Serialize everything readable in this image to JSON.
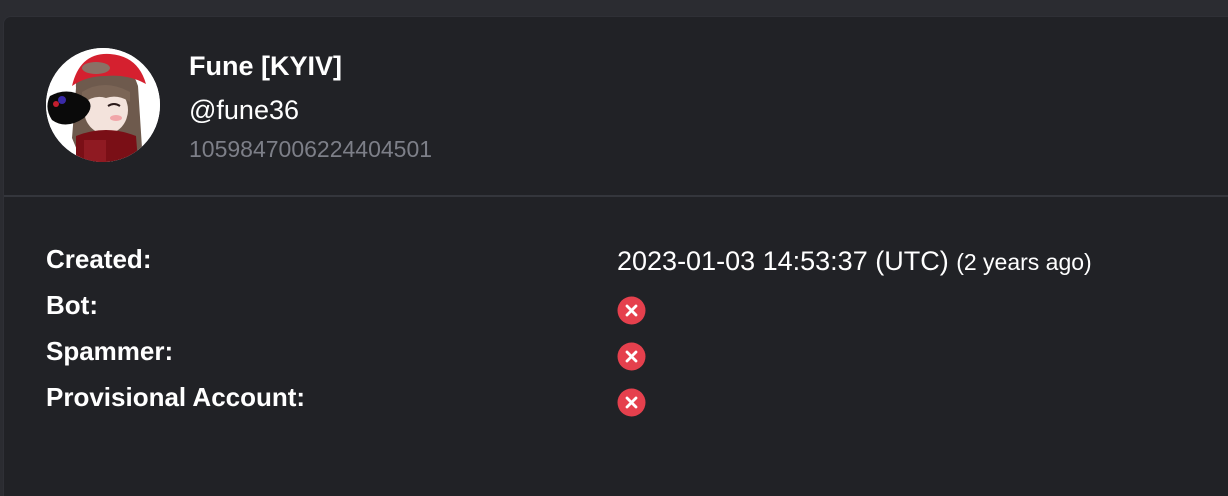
{
  "profile": {
    "display_name": "Fune [KYIV]",
    "username": "@fune36",
    "user_id": "1059847006224404501",
    "avatar_icon": "anime-avatar-red-cap"
  },
  "details": {
    "created_label": "Created:",
    "created_value": "2023-01-03 14:53:37 (UTC)",
    "created_ago": "(2 years ago)",
    "bot_label": "Bot:",
    "bot_value_icon": "x-circle-icon",
    "spammer_label": "Spammer:",
    "spammer_value_icon": "x-circle-icon",
    "provisional_label": "Provisional Account:",
    "provisional_value_icon": "x-circle-icon"
  },
  "colors": {
    "background": "#212226",
    "false_indicator": "#e5404d",
    "muted_text": "#7d7f88"
  }
}
